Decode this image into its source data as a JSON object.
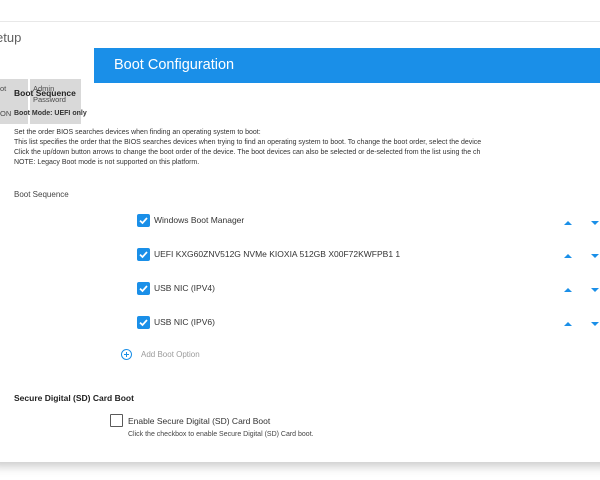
{
  "app": {
    "title": "etup"
  },
  "nav": {
    "tiles": [
      {
        "line1": "ot",
        "selected_text": "ON"
      },
      {
        "line1": "Admin",
        "line2": "Password"
      }
    ]
  },
  "header": {
    "title": "Boot Configuration",
    "color": "#1a8fe8"
  },
  "boot_sequence": {
    "heading": "Boot Sequence",
    "mode": "Boot Mode: UEFI only",
    "description": [
      "Set the order BIOS searches devices when finding an operating system to boot:",
      "This list specifies the order that the BIOS searches devices when trying to find an operating system to boot.  To change the boot order, select the device",
      "Click the up/down button arrows to change the boot order of the device.  The boot devices can also be selected or de-selected from the list using the ch",
      "NOTE: Legacy Boot mode is not supported on this platform."
    ],
    "list_label": "Boot Sequence",
    "items": [
      {
        "label": "Windows Boot Manager",
        "checked": true
      },
      {
        "label": "UEFI KXG60ZNV512G NVMe KIOXIA 512GB X00F72KWFPB1 1",
        "checked": true
      },
      {
        "label": "USB NIC (IPV4)",
        "checked": true
      },
      {
        "label": "USB NIC (IPV6)",
        "checked": true
      }
    ],
    "add_label": "Add Boot Option",
    "icons": {
      "up": "chevron-up-icon",
      "down": "chevron-down-icon",
      "add": "plus-circle-icon",
      "check": "checkmark-icon"
    }
  },
  "sd_card": {
    "heading": "Secure Digital (SD) Card Boot",
    "checkbox_label": "Enable Secure Digital (SD) Card Boot",
    "checked": false,
    "help": "Click the checkbox to enable Secure Digital (SD) Card boot."
  }
}
